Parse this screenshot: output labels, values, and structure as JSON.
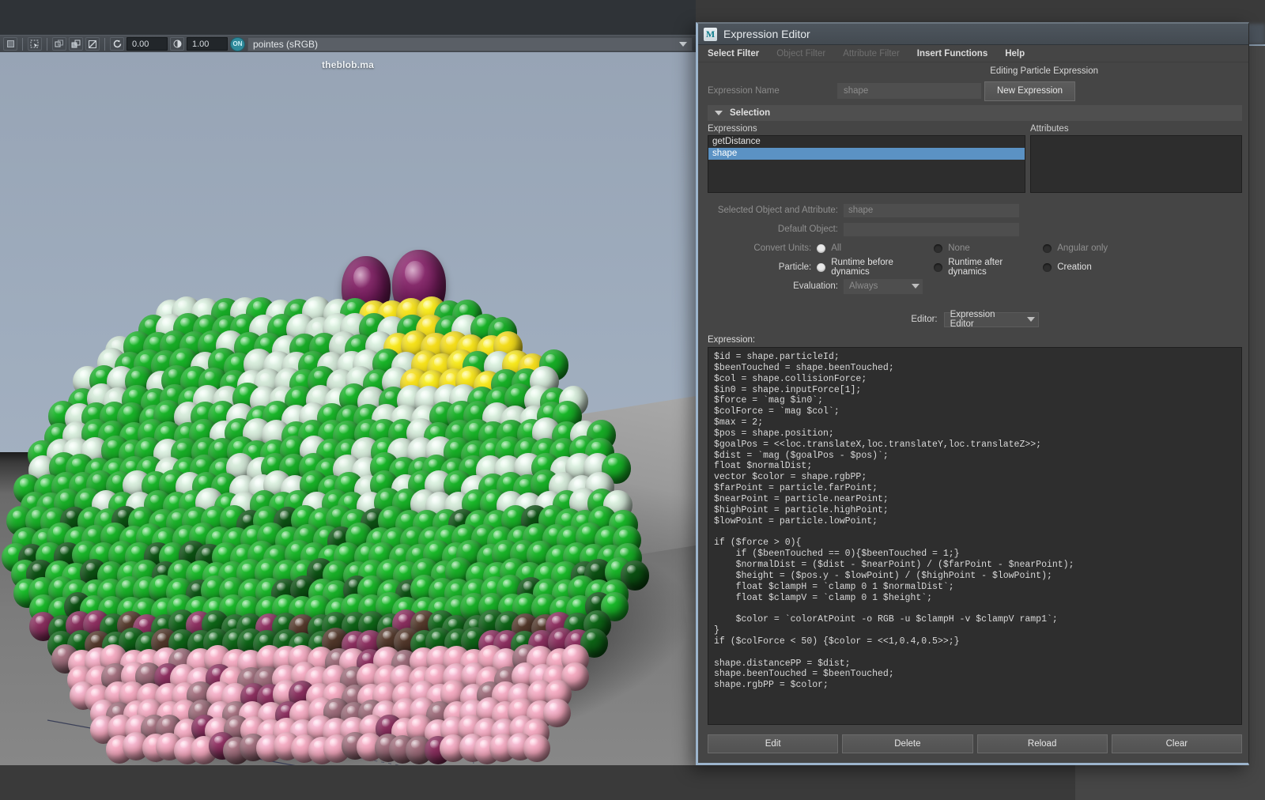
{
  "maya": {
    "viewport_title": "theblob.ma",
    "toolbar": {
      "icons": [
        "select-box-icon",
        "marquee-select-icon",
        "snap-grid-icon",
        "snap-curve-icon",
        "snap-point-icon",
        "rotate-snap-icon"
      ],
      "value_left": "0.00",
      "value_right": "1.00",
      "badge": "ON",
      "color_profile": "pointes (sRGB)"
    }
  },
  "dialog": {
    "title": "Expression Editor",
    "logo": "M",
    "menus": [
      {
        "label": "Select Filter",
        "enabled": true
      },
      {
        "label": "Object Filter",
        "enabled": false
      },
      {
        "label": "Attribute Filter",
        "enabled": false
      },
      {
        "label": "Insert Functions",
        "enabled": true
      },
      {
        "label": "Help",
        "enabled": true
      }
    ],
    "heading": "Editing Particle Expression",
    "expression_name_label": "Expression Name",
    "expression_name_value": "shape",
    "new_expression_button": "New Expression",
    "selection_section": "Selection",
    "expressions_label": "Expressions",
    "attributes_label": "Attributes",
    "expressions_items": [
      {
        "label": "getDistance",
        "selected": false
      },
      {
        "label": "shape",
        "selected": true
      }
    ],
    "attributes_items": [],
    "selected_object_label": "Selected Object and Attribute:",
    "selected_object_value": "shape",
    "default_object_label": "Default Object:",
    "default_object_value": "",
    "convert_units_label": "Convert Units:",
    "convert_units_options": [
      {
        "label": "All",
        "selected": true
      },
      {
        "label": "None",
        "selected": false
      },
      {
        "label": "Angular only",
        "selected": false
      }
    ],
    "particle_label": "Particle:",
    "particle_options": [
      {
        "label": "Runtime before dynamics",
        "selected": true
      },
      {
        "label": "Runtime after dynamics",
        "selected": false
      },
      {
        "label": "Creation",
        "selected": false
      }
    ],
    "evaluation_label": "Evaluation:",
    "evaluation_value": "Always",
    "editor_label": "Editor:",
    "editor_value": "Expression Editor",
    "expression_label": "Expression:",
    "expression_code": "$id = shape.particleId;\n$beenTouched = shape.beenTouched;\n$col = shape.collisionForce;\n$in0 = shape.inputForce[1];\n$force = `mag $in0`;\n$colForce = `mag $col`;\n$max = 2;\n$pos = shape.position;\n$goalPos = <<loc.translateX,loc.translateY,loc.translateZ>>;\n$dist = `mag ($goalPos - $pos)`;\nfloat $normalDist;\nvector $color = shape.rgbPP;\n$farPoint = particle.farPoint;\n$nearPoint = particle.nearPoint;\n$highPoint = particle.highPoint;\n$lowPoint = particle.lowPoint;\n\nif ($force > 0){\n    if ($beenTouched == 0){$beenTouched = 1;}\n    $normalDist = ($dist - $nearPoint) / ($farPoint - $nearPoint);\n    $height = ($pos.y - $lowPoint) / ($highPoint - $lowPoint);\n    float $clampH = `clamp 0 1 $normalDist`;\n    float $clampV = `clamp 0 1 $height`;\n\n    $color = `colorAtPoint -o RGB -u $clampH -v $clampV ramp1`;\n}\nif ($colForce < 50) {$color = <<1,0.4,0.5>>;}\n\nshape.distancePP = $dist;\nshape.beenTouched = $beenTouched;\nshape.rgbPP = $color;",
    "buttons": [
      {
        "label": "Edit"
      },
      {
        "label": "Delete"
      },
      {
        "label": "Reload"
      },
      {
        "label": "Clear"
      }
    ]
  },
  "colors": {
    "selection_blue": "#5b92c4",
    "window_border": "#9cb4cc",
    "panel_bg": "#454545",
    "code_bg": "#2e2e2e",
    "sky": "#9aa7b8",
    "ground": "#7c7c7c",
    "eye_purple": "#6b1a55",
    "ball_green": "#16a324",
    "ball_pale": "#c9ddcd",
    "ball_yellow": "#ead41a",
    "ball_pink": "#e99fb4",
    "ball_magenta": "#7d2a55",
    "ball_brown": "#4a3226"
  }
}
